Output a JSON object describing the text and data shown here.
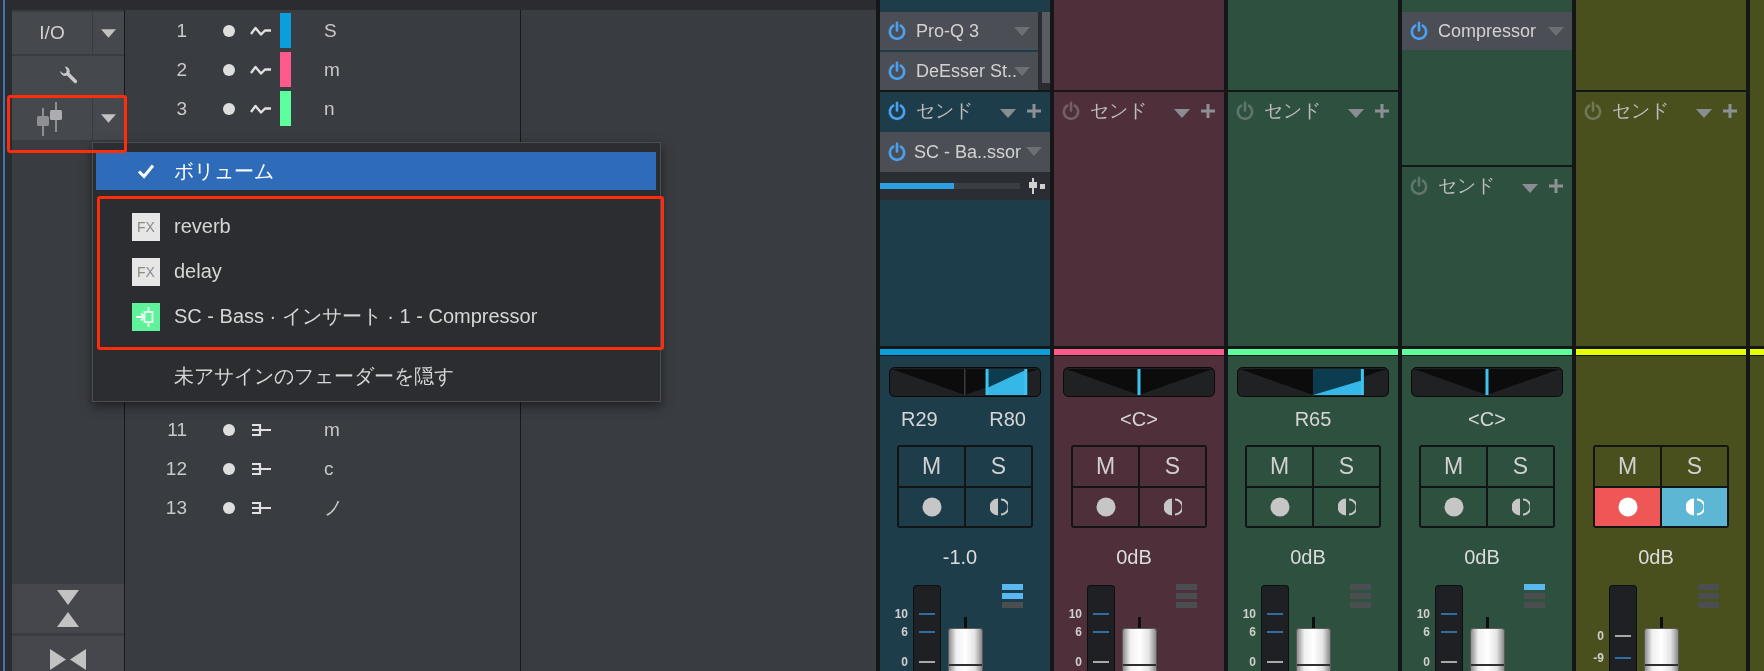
{
  "sidebar": {
    "buttons": [
      {
        "kind": "io",
        "label": "I/O",
        "dropdown": true,
        "highlighted": false
      },
      {
        "kind": "wrench",
        "dropdown": false,
        "highlighted": false
      },
      {
        "kind": "faders",
        "dropdown": true,
        "highlighted": true
      }
    ],
    "footer_buttons": [
      {
        "kind": "vertical"
      },
      {
        "kind": "horizontal"
      }
    ]
  },
  "track_list": {
    "groups": [
      {
        "tracks": [
          {
            "number": "1",
            "visible": true,
            "kind": "audio",
            "color": "#0a9fdc",
            "name": "S"
          },
          {
            "number": "2",
            "visible": true,
            "kind": "audio",
            "color": "#ff5a8c",
            "name": "m"
          },
          {
            "number": "3",
            "visible": true,
            "kind": "audio",
            "color": "#5cff9c",
            "name": "n"
          }
        ]
      },
      {
        "tracks": [
          {
            "number": "11",
            "visible": true,
            "kind": "instrument",
            "name": "m"
          },
          {
            "number": "12",
            "visible": true,
            "kind": "instrument",
            "name": "c"
          },
          {
            "number": "13",
            "visible": true,
            "kind": "instrument",
            "name": "ノ"
          }
        ]
      }
    ]
  },
  "menu": {
    "groups": [
      {
        "highlighted": false,
        "items": [
          {
            "kind": "plain",
            "label": "ボリューム",
            "selected": true
          }
        ]
      },
      {
        "highlighted": true,
        "items": [
          {
            "kind": "fx",
            "badge": "FX",
            "label": "reverb",
            "selected": false
          },
          {
            "kind": "fx",
            "badge": "FX",
            "label": "delay",
            "selected": false
          },
          {
            "kind": "insert",
            "label": "SC - Bass · インサート · 1 - Compressor",
            "selected": false
          }
        ]
      },
      {
        "highlighted": false,
        "items": [
          {
            "kind": "plain",
            "label": "未アサインのフェーダーを隠す",
            "selected": false
          }
        ]
      }
    ]
  },
  "mixer": {
    "channels": [
      {
        "color": "#0aa0dc",
        "inserts": {
          "expanded": false,
          "slots": [
            {
              "name": "Pro-Q 3",
              "on": true
            },
            {
              "name": "DeEsser St..",
              "on": true
            }
          ]
        },
        "sends": {
          "label": "センド",
          "on": true,
          "slots": [
            {
              "name": "SC - Ba..ssor",
              "on": true,
              "level": 0.53
            }
          ]
        },
        "pan": {
          "labels": [
            "R29",
            "R80"
          ],
          "handles": [
            {
              "level": 0.645
            },
            {
              "level": 0.9
            }
          ]
        },
        "mute": {
          "label": "M",
          "on": false
        },
        "solo": {
          "label": "S",
          "on": false
        },
        "record_armed": false,
        "monitor_on": false,
        "volume": "-1.0",
        "meter_scale": [
          "10",
          "6",
          "0"
        ],
        "activity": {
          "level": 0.67
        }
      },
      {
        "color": "#ff5a8c",
        "inserts": {
          "expanded": false
        },
        "sends": {
          "label": "センド",
          "on": false
        },
        "pan": {
          "labels": [
            "<C>"
          ],
          "handles": [
            {
              "level": 0.5
            }
          ]
        },
        "mute": {
          "label": "M",
          "on": false
        },
        "solo": {
          "label": "S",
          "on": false
        },
        "record_armed": false,
        "monitor_on": false,
        "volume": "0dB",
        "meter_scale": [
          "10",
          "6",
          "0"
        ],
        "activity": {
          "level": 0
        }
      },
      {
        "color": "#5cff9c",
        "inserts": {
          "expanded": false
        },
        "sends": {
          "label": "センド",
          "on": false
        },
        "pan": {
          "labels": [
            "R65"
          ],
          "handles": [
            {
              "level": 0.825
            }
          ]
        },
        "mute": {
          "label": "M",
          "on": false
        },
        "solo": {
          "label": "S",
          "on": false
        },
        "record_armed": false,
        "monitor_on": false,
        "volume": "0dB",
        "meter_scale": [
          "10",
          "6",
          "0"
        ],
        "activity": {
          "level": 0
        }
      },
      {
        "color": "#5cff9c",
        "inserts": {
          "expanded": true,
          "slots": [
            {
              "name": "Compressor",
              "on": true
            }
          ]
        },
        "sends": {
          "label": "センド",
          "on": false
        },
        "pan": {
          "labels": [
            "<C>"
          ],
          "handles": [
            {
              "level": 0.5
            }
          ]
        },
        "mute": {
          "label": "M",
          "on": false
        },
        "solo": {
          "label": "S",
          "on": false
        },
        "record_armed": false,
        "monitor_on": false,
        "volume": "0dB",
        "meter_scale": [
          "10",
          "6",
          "0"
        ],
        "activity": {
          "level": 0.33
        }
      },
      {
        "color": "#e6ff00",
        "inserts": {
          "expanded": false
        },
        "sends": {
          "label": "センド",
          "on": false
        },
        "mute": {
          "label": "M",
          "on": false
        },
        "solo": {
          "label": "S",
          "on": false
        },
        "record_armed": true,
        "monitor_on": true,
        "volume": "0dB",
        "meter_scale": [
          "0",
          "-9"
        ],
        "activity": {
          "level": 0
        }
      },
      {
        "color": "#e6ff00"
      }
    ]
  }
}
